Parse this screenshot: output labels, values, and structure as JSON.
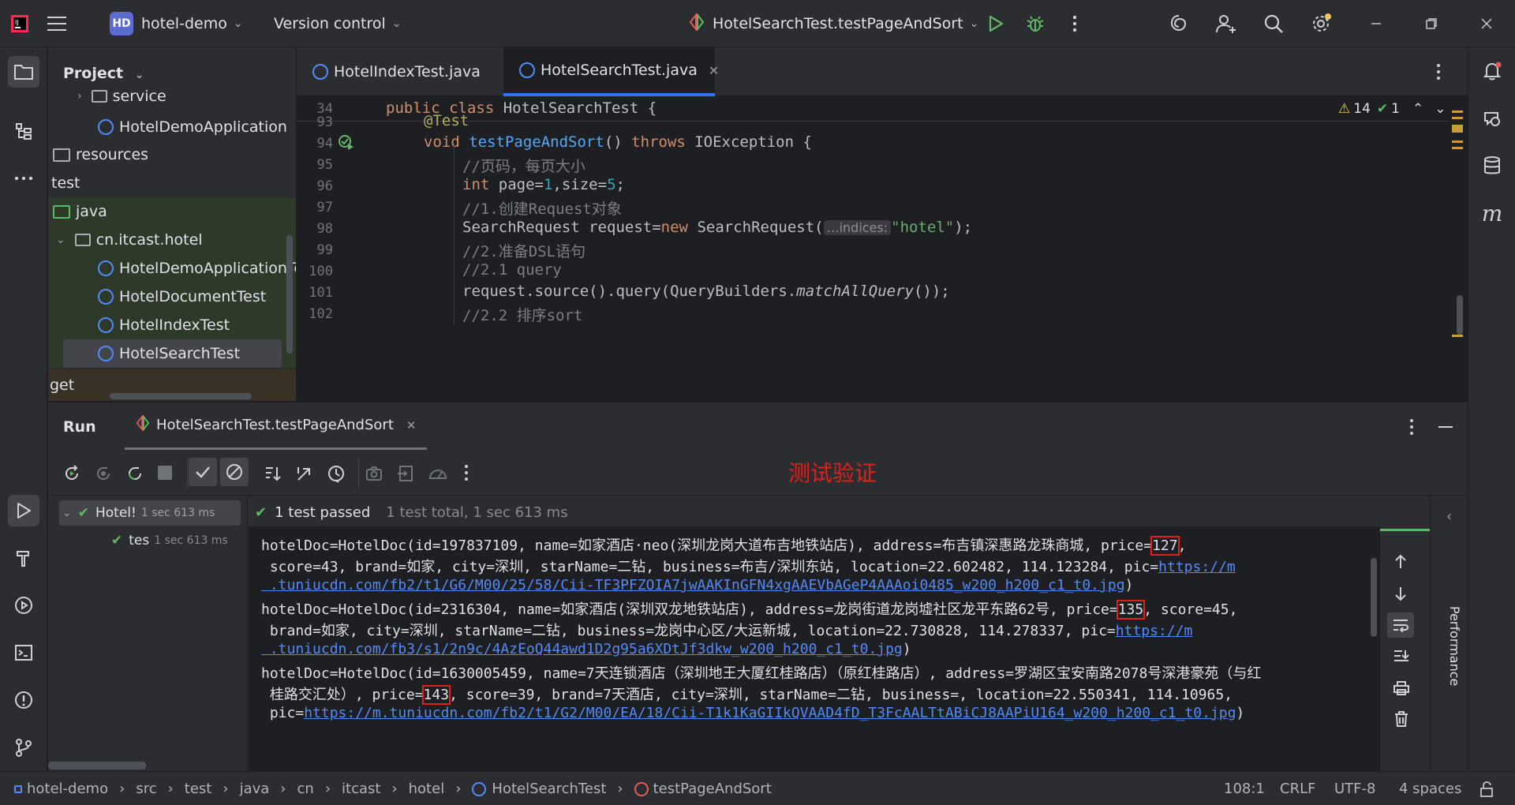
{
  "titlebar": {
    "project_badge": "HD",
    "project_name": "hotel-demo",
    "vcs_label": "Version control",
    "run_config": "HotelSearchTest.testPageAndSort"
  },
  "project_panel": {
    "title": "Project",
    "tree": [
      {
        "label": "service",
        "type": "package"
      },
      {
        "label": "HotelDemoApplication",
        "type": "class"
      },
      {
        "label": "resources",
        "type": "folder"
      },
      {
        "label": "test",
        "type": "text"
      },
      {
        "label": "java",
        "type": "folder"
      },
      {
        "label": "cn.itcast.hotel",
        "type": "package"
      },
      {
        "label": "HotelDemoApplicationTests",
        "type": "class"
      },
      {
        "label": "HotelDocumentTest",
        "type": "class"
      },
      {
        "label": "HotelIndexTest",
        "type": "class"
      },
      {
        "label": "HotelSearchTest",
        "type": "class"
      },
      {
        "label": "get",
        "type": "text"
      }
    ]
  },
  "editor": {
    "tabs": [
      {
        "label": "HotelIndexTest.java",
        "active": false
      },
      {
        "label": "HotelSearchTest.java",
        "active": true
      }
    ],
    "sticky_line_number": "34",
    "sticky_line": "public class HotelSearchTest {",
    "warnings_count": "14",
    "ok_count": "1",
    "line_numbers": [
      "93",
      "94",
      "95",
      "96",
      "97",
      "98",
      "99",
      "100",
      "101",
      "102"
    ],
    "code": {
      "l93": "@Test",
      "l94_kw1": "void",
      "l94_fn": "testPageAndSort",
      "l94_mid": "() ",
      "l94_kw2": "throws",
      "l94_rest": " IOException {",
      "l95": "//页码，每页大小",
      "l96_kw": "int",
      "l96_a": " page=",
      "l96_n1": "1",
      "l96_b": ",size=",
      "l96_n2": "5",
      "l96_c": ";",
      "l97": "//1.创建Request对象",
      "l98_a": "SearchRequest request=",
      "l98_kw": "new",
      "l98_b": " SearchRequest(",
      "l98_hint": "…indices:",
      "l98_str": "\"hotel\"",
      "l98_c": ");",
      "l99": "//2.准备DSL语句",
      "l100": "//2.1 query",
      "l101_a": "request.source().query(QueryBuilders.",
      "l101_it": "matchAllQuery",
      "l101_b": "());",
      "l102": "//2.2 排序sort"
    }
  },
  "run_panel": {
    "title": "Run",
    "tab_label": "HotelSearchTest.testPageAndSort",
    "annotation": "测试验证",
    "tree_root_label": "Hotel!",
    "tree_root_time": "1 sec 613 ms",
    "tree_child_label": "tes",
    "tree_child_time": "1 sec 613 ms",
    "status_passed": "1 test passed",
    "status_total": "1 test total, 1 sec 613 ms",
    "side_label": "Performance",
    "console": {
      "r1a": "hotelDoc=HotelDoc(id=197837109, name=如家酒店·neo(深圳龙岗大道布吉地铁站店), address=布吉镇深惠路龙珠商城, price=",
      "r1price": "127",
      "r1b": ",",
      "r2a": " score=43, brand=如家, city=深圳, starName=二钻, business=布吉/深圳东站, location=22.602482, 114.123284, pic=",
      "r2link": "https://m",
      "r3link": " .tuniucdn.com/fb2/t1/G6/M00/25/58/Cii-TF3PFZOIA7jwAAKInGFN4xgAAEVbAGeP4AAAoi0485_w200_h200_c1_t0.jpg",
      "r3b": ")",
      "r4a": "hotelDoc=HotelDoc(id=2316304, name=如家酒店(深圳双龙地铁站店), address=龙岗街道龙岗墟社区龙平东路62号, price=",
      "r4price": "135",
      "r4b": ", score=45,",
      "r5a": " brand=如家, city=深圳, starName=二钻, business=龙岗中心区/大运新城, location=22.730828, 114.278337, pic=",
      "r5link": "https://m",
      "r6link": " .tuniucdn.com/fb3/s1/2n9c/4AzEoQ44awd1D2g95a6XDtJf3dkw_w200_h200_c1_t0.jpg",
      "r6b": ")",
      "r7a": "hotelDoc=HotelDoc(id=1630005459, name=7天连锁酒店（深圳地王大厦红桂路店）（原红桂路店）, address=罗湖区宝安南路2078号深港豪苑（与红",
      "r8a": " 桂路交汇处）, price=",
      "r8price": "143",
      "r8b": ", score=39, brand=7天酒店, city=深圳, starName=二钻, business=, location=22.550341, 114.10965,",
      "r9a": " pic=",
      "r9link": "https://m.tuniucdn.com/fb2/t1/G2/M00/EA/18/Cii-T1k1KaGIIkQVAAD4fD_T3FcAALTtABiCJ8AAPiU164_w200_h200_c1_t0.jpg",
      "r9b": ")"
    }
  },
  "statusbar": {
    "crumbs": [
      "hotel-demo",
      "src",
      "test",
      "java",
      "cn",
      "itcast",
      "hotel",
      "HotelSearchTest",
      "testPageAndSort"
    ],
    "position": "108:1",
    "line_sep": "CRLF",
    "encoding": "UTF-8",
    "indent": "4 spaces"
  },
  "colors": {
    "accent": "#3574f0",
    "pass": "#5fb865",
    "highlight_box": "#e0201b",
    "annotation": "#e0201b"
  }
}
